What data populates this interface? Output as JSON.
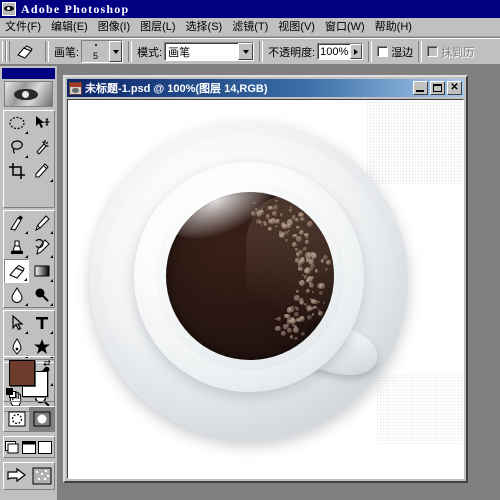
{
  "app": {
    "title": "Adobe Photoshop",
    "icon": "photoshop-eye-icon"
  },
  "menubar": {
    "items": [
      {
        "label": "文件(F)"
      },
      {
        "label": "编辑(E)"
      },
      {
        "label": "图像(I)"
      },
      {
        "label": "图层(L)"
      },
      {
        "label": "选择(S)"
      },
      {
        "label": "滤镜(T)"
      },
      {
        "label": "视图(V)"
      },
      {
        "label": "窗口(W)"
      },
      {
        "label": "帮助(H)"
      }
    ]
  },
  "options_bar": {
    "tool_icon": "eraser-icon",
    "brush_label": "画笔:",
    "brush_size": "5",
    "mode_label": "模式:",
    "mode_value": "画笔",
    "opacity_label": "不透明度:",
    "opacity_value": "100%",
    "wet_edges_label": "湿边",
    "erase_to_history_label": "抹到历"
  },
  "toolbox": {
    "banner_icon": "photoshop-eye-banner",
    "tools": [
      {
        "name": "marquee-tool",
        "icon": "ellipse-marquee-icon",
        "selected": false
      },
      {
        "name": "move-tool",
        "icon": "move-arrow-icon",
        "selected": false
      },
      {
        "name": "lasso-tool",
        "icon": "lasso-icon",
        "selected": false
      },
      {
        "name": "magic-wand-tool",
        "icon": "magic-wand-icon",
        "selected": false
      },
      {
        "name": "crop-tool",
        "icon": "crop-icon",
        "selected": false
      },
      {
        "name": "slice-tool",
        "icon": "slice-knife-icon",
        "selected": false
      },
      {
        "name": "healing-brush-tool",
        "icon": "healing-brush-icon",
        "selected": false
      },
      {
        "name": "brush-tool",
        "icon": "paintbrush-icon",
        "selected": false
      },
      {
        "name": "clone-stamp-tool",
        "icon": "stamp-icon",
        "selected": false
      },
      {
        "name": "history-brush-tool",
        "icon": "history-brush-icon",
        "selected": false
      },
      {
        "name": "eraser-tool",
        "icon": "eraser-icon",
        "selected": true
      },
      {
        "name": "gradient-tool",
        "icon": "gradient-icon",
        "selected": false
      },
      {
        "name": "blur-tool",
        "icon": "waterdrop-icon",
        "selected": false
      },
      {
        "name": "dodge-tool",
        "icon": "dodge-icon",
        "selected": false
      },
      {
        "name": "path-selection-tool",
        "icon": "path-arrow-icon",
        "selected": false
      },
      {
        "name": "type-tool",
        "icon": "type-t-icon",
        "selected": false
      },
      {
        "name": "pen-tool",
        "icon": "pen-icon",
        "selected": false
      },
      {
        "name": "shape-tool",
        "icon": "custom-shape-icon",
        "selected": false
      },
      {
        "name": "notes-tool",
        "icon": "notes-icon",
        "selected": false
      },
      {
        "name": "eyedropper-tool",
        "icon": "eyedropper-icon",
        "selected": false
      },
      {
        "name": "hand-tool",
        "icon": "hand-icon",
        "selected": false
      },
      {
        "name": "zoom-tool",
        "icon": "magnifier-icon",
        "selected": false
      }
    ],
    "colors": {
      "foreground": "#6e3c2d",
      "background": "#ffffff",
      "swap_icon": "swap-arrows-icon",
      "default_icon": "default-colors-icon"
    },
    "quick_mask": [
      {
        "name": "standard-mode",
        "icon": "standard-mode-icon",
        "active": false
      },
      {
        "name": "quick-mask-mode",
        "icon": "quick-mask-icon",
        "active": true
      }
    ],
    "screen_modes": [
      {
        "name": "standard-screen-mode",
        "icon": "standard-screen-icon",
        "active": true
      },
      {
        "name": "full-screen-with-menubar",
        "icon": "full-screen-menubar-icon",
        "active": false
      },
      {
        "name": "full-screen-mode",
        "icon": "full-screen-icon",
        "active": false
      }
    ],
    "jump_to": [
      {
        "name": "jump-to-imageready",
        "icon": "jump-arrow-icon"
      },
      {
        "name": "imageready-preview",
        "icon": "imageready-icon"
      }
    ]
  },
  "document": {
    "title": "未标题-1.psd @ 100%(图层  14,RGB)",
    "icon": "psd-document-icon",
    "buttons": {
      "minimize": "_",
      "maximize": "□",
      "close": "✕"
    },
    "artwork": {
      "name": "coffee-cup-top-view",
      "background": "#ffffff",
      "coffee_color": "#2a1712",
      "cup_color": "#f5f7f8",
      "saucer_color": "#e4e7ea",
      "foam_color": "#c6b09c"
    }
  }
}
